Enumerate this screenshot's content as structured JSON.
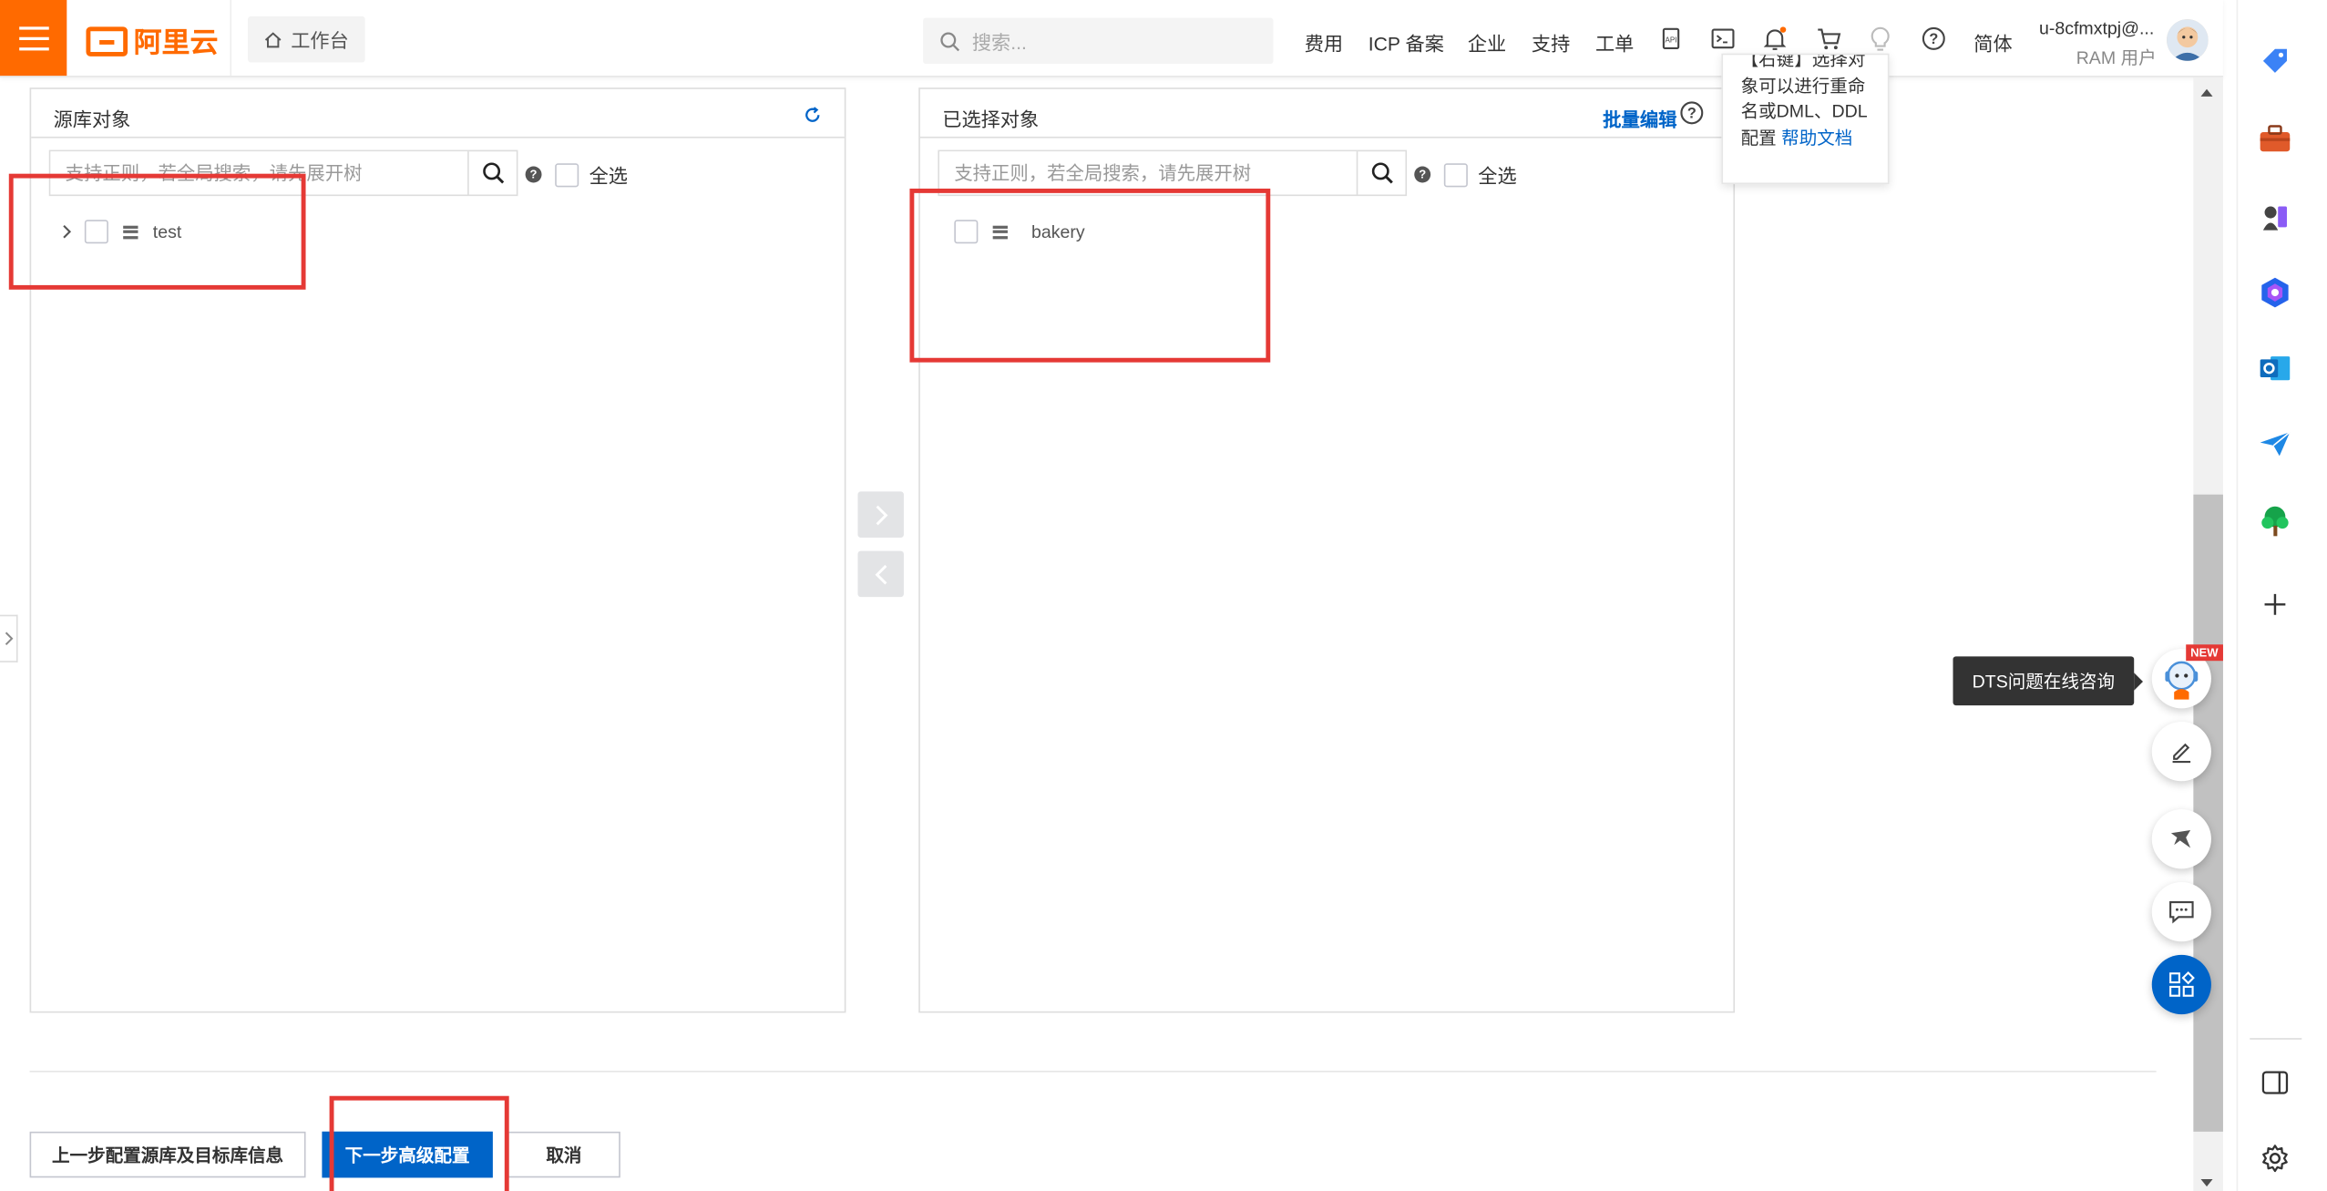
{
  "topbar": {
    "logo_text": "阿里云",
    "workbench_label": "工作台",
    "search_placeholder": "搜索...",
    "nav": [
      "费用",
      "ICP 备案",
      "企业",
      "支持",
      "工单"
    ],
    "lang": "简体",
    "user_name": "u-8cfmxtpj@...",
    "user_role": "RAM 用户",
    "accent": "#ff6a00"
  },
  "source": {
    "title": "源库对象",
    "search_placeholder": "支持正则，若全局搜索，请先展开树",
    "select_all": "全选",
    "nodes": [
      {
        "label": "test"
      }
    ]
  },
  "selected": {
    "title": "已选择对象",
    "batch_edit": "批量编辑",
    "search_placeholder": "支持正则，若全局搜索，请先展开树",
    "select_all": "全选",
    "nodes": [
      {
        "label": "bakery"
      }
    ]
  },
  "tooltip": {
    "line1": "【右键】选择对",
    "line2": "象可以进行重命",
    "line3": "名或DML、DDL",
    "line4_prefix": "配置",
    "link": "帮助文档"
  },
  "footer": {
    "prev": "上一步配置源库及目标库信息",
    "next": "下一步高级配置",
    "cancel": "取消",
    "primary_color": "#0064c8"
  },
  "floating": {
    "dts_tip": "DTS问题在线咨询",
    "new_badge": "NEW"
  },
  "icons": {
    "edge_sidebar": [
      "tag-icon",
      "toolbox-icon",
      "chess-icon",
      "copilot-icon",
      "outlook-icon",
      "send-icon",
      "tree-icon",
      "plus-icon",
      "sidebar-toggle-icon",
      "settings-icon"
    ]
  }
}
